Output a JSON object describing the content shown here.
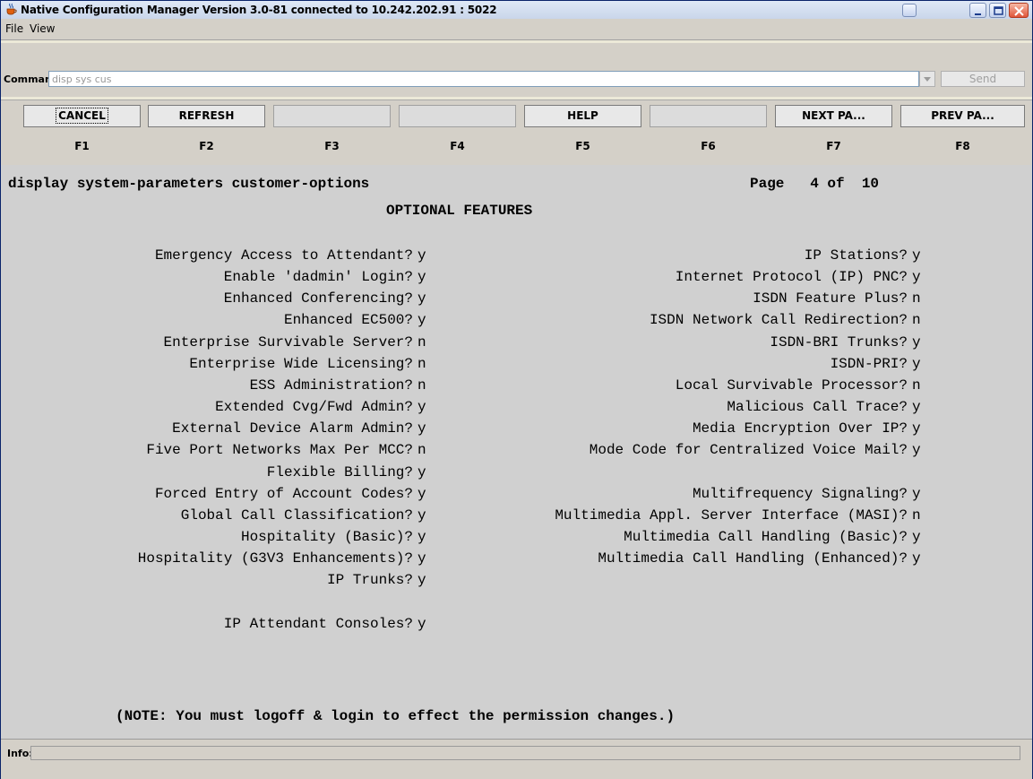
{
  "window": {
    "title": "Native Configuration Manager Version 3.0-81 connected to 10.242.202.91 : 5022"
  },
  "menu": {
    "items": [
      "File",
      "View"
    ]
  },
  "command": {
    "label": "Command:",
    "value": "disp sys cus",
    "send_label": "Send"
  },
  "fkeys": [
    {
      "label": "CANCEL",
      "key": "F1"
    },
    {
      "label": "REFRESH",
      "key": "F2"
    },
    {
      "label": "",
      "key": "F3"
    },
    {
      "label": "",
      "key": "F4"
    },
    {
      "label": "HELP",
      "key": "F5"
    },
    {
      "label": "",
      "key": "F6"
    },
    {
      "label": "NEXT  PA...",
      "key": "F7"
    },
    {
      "label": "PREV  PA...",
      "key": "F8"
    }
  ],
  "screen": {
    "command_echo": "display system-parameters customer-options",
    "page_info": "Page   4 of  10",
    "section_title": "OPTIONAL FEATURES",
    "left_column": [
      {
        "label": "Emergency Access to Attendant?",
        "value": "y"
      },
      {
        "label": "Enable 'dadmin' Login?",
        "value": "y"
      },
      {
        "label": "Enhanced Conferencing?",
        "value": "y"
      },
      {
        "label": "Enhanced EC500?",
        "value": "y"
      },
      {
        "label": "Enterprise Survivable Server?",
        "value": "n"
      },
      {
        "label": "Enterprise Wide Licensing?",
        "value": "n"
      },
      {
        "label": "ESS Administration?",
        "value": "n"
      },
      {
        "label": "Extended Cvg/Fwd Admin?",
        "value": "y"
      },
      {
        "label": "External Device Alarm Admin?",
        "value": "y"
      },
      {
        "label": "Five Port Networks Max Per MCC?",
        "value": "n"
      },
      {
        "label": "Flexible Billing?",
        "value": "y"
      },
      {
        "label": "Forced Entry of Account Codes?",
        "value": "y"
      },
      {
        "label": "Global Call Classification?",
        "value": "y"
      },
      {
        "label": "Hospitality (Basic)?",
        "value": "y"
      },
      {
        "label": "Hospitality (G3V3 Enhancements)?",
        "value": "y"
      },
      {
        "label": "IP Trunks?",
        "value": "y"
      },
      {
        "label": "",
        "value": ""
      },
      {
        "label": "IP Attendant Consoles?",
        "value": "y"
      }
    ],
    "right_column": [
      {
        "label": "IP Stations?",
        "value": "y"
      },
      {
        "label": "Internet Protocol (IP) PNC?",
        "value": "y"
      },
      {
        "label": "ISDN Feature Plus?",
        "value": "n"
      },
      {
        "label": "ISDN Network Call Redirection?",
        "value": "n"
      },
      {
        "label": "ISDN-BRI Trunks?",
        "value": "y"
      },
      {
        "label": "ISDN-PRI?",
        "value": "y"
      },
      {
        "label": "Local Survivable Processor?",
        "value": "n"
      },
      {
        "label": "Malicious Call Trace?",
        "value": "y"
      },
      {
        "label": "Media Encryption Over IP?",
        "value": "y"
      },
      {
        "label": "Mode Code for Centralized Voice Mail?",
        "value": "y"
      },
      {
        "label": "",
        "value": ""
      },
      {
        "label": "Multifrequency Signaling?",
        "value": "y"
      },
      {
        "label": "Multimedia Appl. Server Interface (MASI)?",
        "value": "n"
      },
      {
        "label": "Multimedia Call Handling (Basic)?",
        "value": "y"
      },
      {
        "label": "Multimedia Call Handling (Enhanced)?",
        "value": "y"
      }
    ],
    "note": "(NOTE: You must logoff & login to effect the permission changes.)"
  },
  "info": {
    "label": "Info:",
    "value": ""
  }
}
